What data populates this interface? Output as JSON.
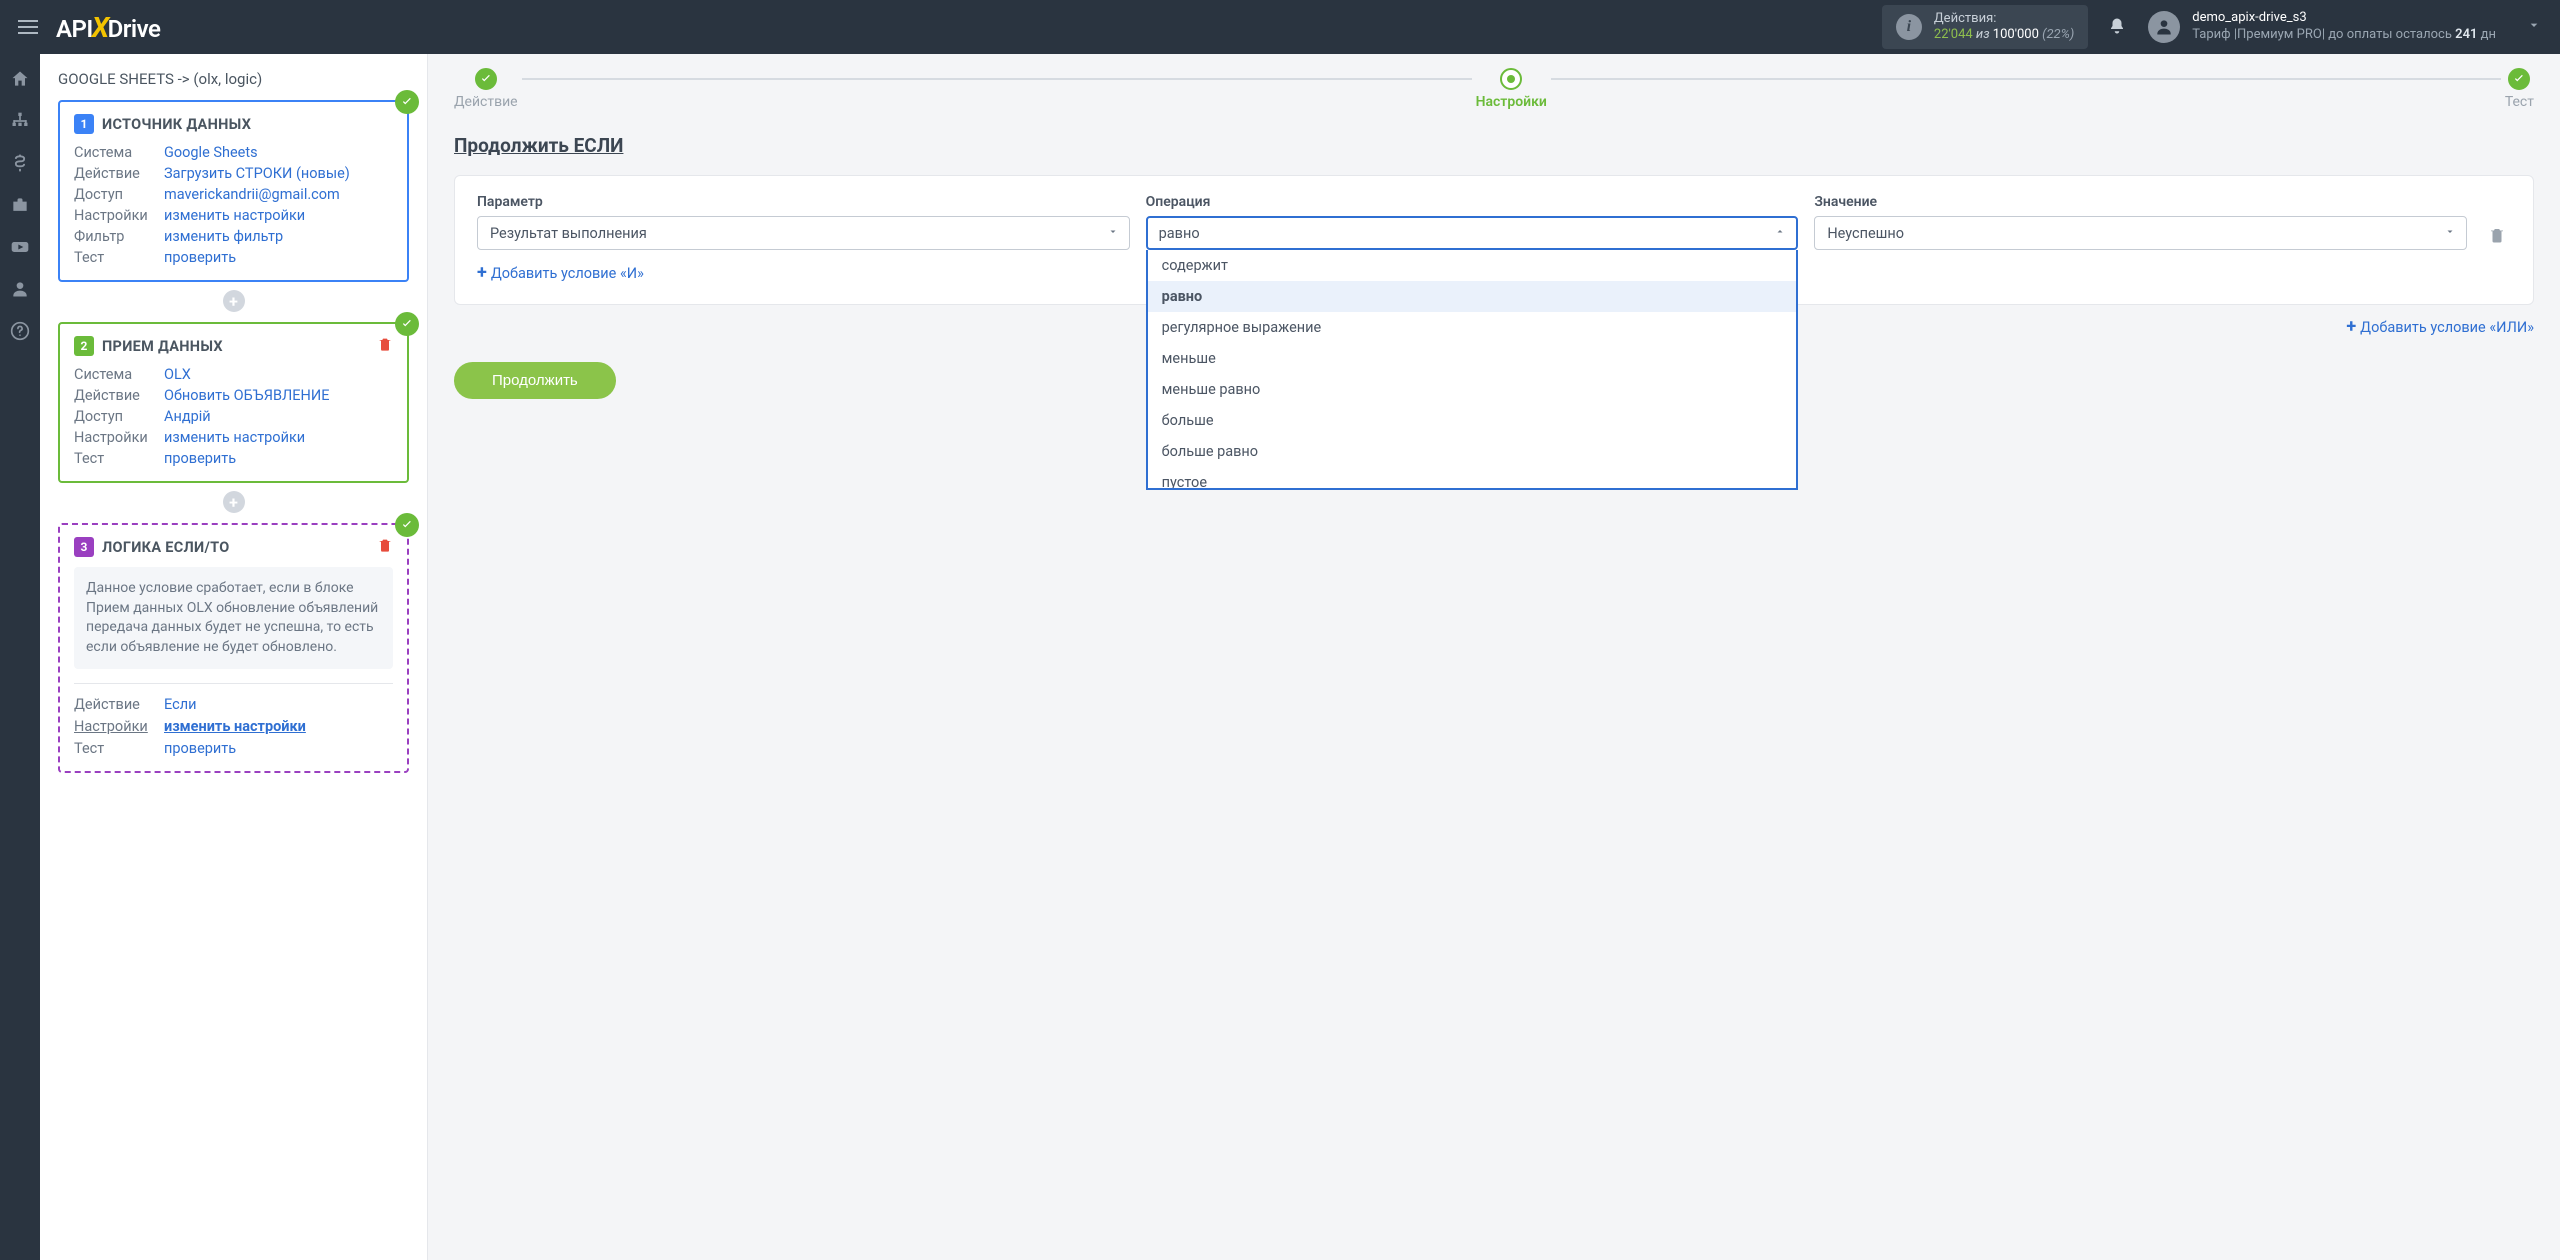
{
  "topbar": {
    "actions_label": "Действия:",
    "actions_used": "22'044",
    "actions_sep": " из ",
    "actions_total": "100'000",
    "actions_pct": "(22%)",
    "username": "demo_apix-drive_s3",
    "tariff_prefix": "Тариф |",
    "tariff_name": "Премиум PRO",
    "tariff_mid": "| до оплаты осталось ",
    "tariff_days": "241",
    "tariff_suffix": " дн"
  },
  "breadcrumb": "GOOGLE SHEETS -> (olx, logic)",
  "step1": {
    "title": "ИСТОЧНИК ДАННЫХ",
    "rows": {
      "system_k": "Система",
      "system_v": "Google Sheets",
      "action_k": "Действие",
      "action_v": "Загрузить СТРОКИ (новые)",
      "access_k": "Доступ",
      "access_v": "maverickandrii@gmail.com",
      "settings_k": "Настройки",
      "settings_v": "изменить настройки",
      "filter_k": "Фильтр",
      "filter_v": "изменить фильтр",
      "test_k": "Тест",
      "test_v": "проверить"
    }
  },
  "step2": {
    "title": "ПРИЕМ ДАННЫХ",
    "rows": {
      "system_k": "Система",
      "system_v": "OLX",
      "action_k": "Действие",
      "action_v": "Обновить ОБЪЯВЛЕНИЕ",
      "access_k": "Доступ",
      "access_v": "Андрій",
      "settings_k": "Настройки",
      "settings_v": "изменить настройки",
      "test_k": "Тест",
      "test_v": "проверить"
    }
  },
  "step3": {
    "title": "ЛОГИКА ЕСЛИ/ТО",
    "desc": "Данное условие сработает, если в блоке Прием данных OLX обновление объявлений передача данных будет не успешна, то есть если объявление не будет обновлено.",
    "rows": {
      "action_k": "Действие",
      "action_v": "Если",
      "settings_k": "Настройки",
      "settings_v": "изменить настройки",
      "test_k": "Тест",
      "test_v": "проверить"
    }
  },
  "wizard": {
    "s1": "Действие",
    "s2": "Настройки",
    "s3": "Тест"
  },
  "main": {
    "title": "Продолжить ЕСЛИ",
    "param_label": "Параметр",
    "op_label": "Операция",
    "value_label": "Значение",
    "param_value": "Результат выполнения",
    "op_value": "равно",
    "value_value": "Неуспешно",
    "add_and": "Добавить условие «И»",
    "add_or": "Добавить условие «ИЛИ»",
    "continue": "Продолжить",
    "op_options": [
      "содержит",
      "равно",
      "регулярное выражение",
      "меньше",
      "меньше равно",
      "больше",
      "больше равно",
      "пустое"
    ]
  }
}
